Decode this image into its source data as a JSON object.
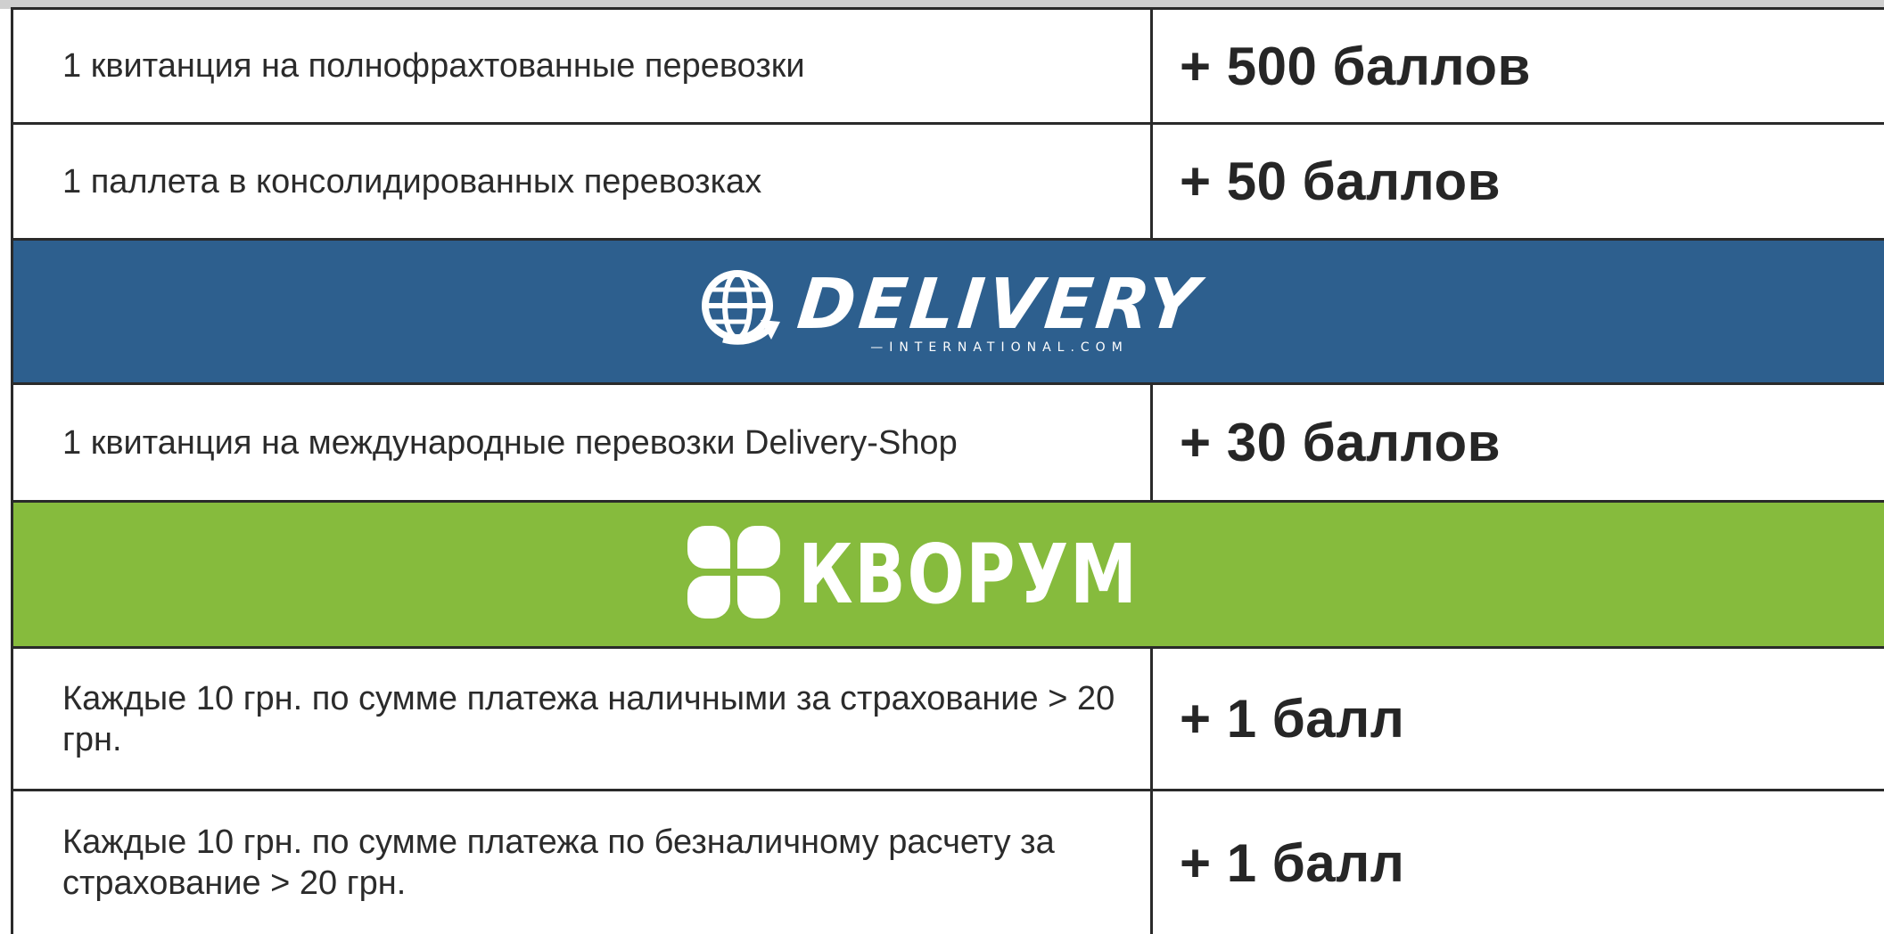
{
  "rows_top": [
    {
      "description": "1 квитанция  на полнофрахтованные перевозки",
      "points": "+ 500 баллов"
    },
    {
      "description": "1 паллета в консолидированных перевозках",
      "points": "+ 50 баллов"
    }
  ],
  "delivery_banner": {
    "logo_word": "DELIVERY",
    "logo_sub": "—INTERNATIONAL.COM",
    "background_color": "#2d5f8e",
    "icon": "globe-arrow-icon"
  },
  "rows_delivery": [
    {
      "description": "1 квитанция на международные перевозки Delivery-Shop",
      "points": "+ 30 баллов"
    }
  ],
  "kvorum_banner": {
    "logo_word": "КВОРУМ",
    "background_color": "#86bb3d",
    "icon": "clover-icon"
  },
  "rows_kvorum": [
    {
      "description": "Каждые 10 грн. по сумме платежа наличными за страхование > 20 грн.",
      "points": "+ 1 балл"
    },
    {
      "description": "Каждые 10 грн. по сумме платежа по безналичному расчету за страхование > 20 грн.",
      "points": "+ 1 балл"
    }
  ]
}
